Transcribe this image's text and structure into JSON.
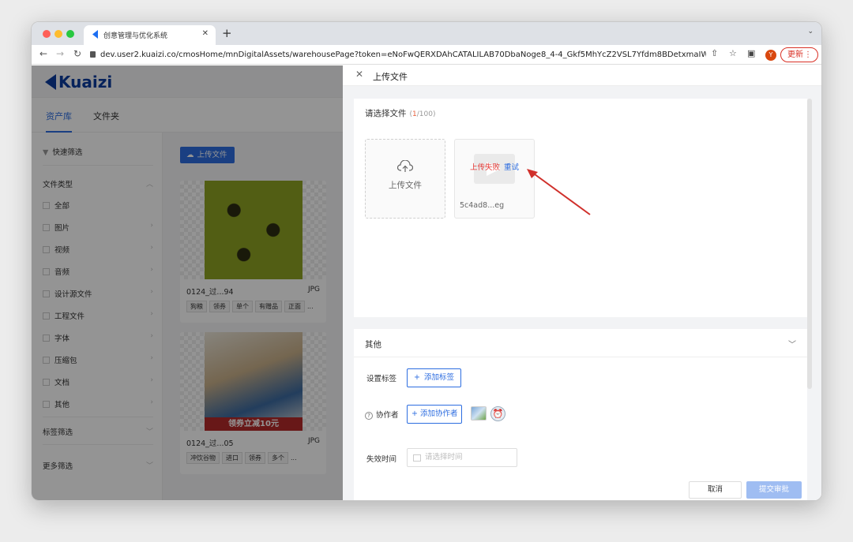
{
  "browser": {
    "tab_title": "创意管理与优化系统",
    "url": "dev.user2.kuaizi.co/cmosHome/mnDigitalAssets/warehousePage?token=eNoFwQERXDAhCATALILAB70DbaNoge8_4-4_Gkf5MhYcZ2VSL7Yfdm8BDetxmaIWJgoa...",
    "avatar_letter": "Y",
    "update_label": "更新"
  },
  "app": {
    "logo": "Kuaizi",
    "tabs": [
      "资产库",
      "文件夹"
    ],
    "upload_button": "上传文件"
  },
  "sidebar": {
    "quick_filter": "快速筛选",
    "file_type": "文件类型",
    "items": [
      "全部",
      "图片",
      "视频",
      "音频",
      "设计源文件",
      "工程文件",
      "字体",
      "压缩包",
      "文档",
      "其他"
    ],
    "tag_filter": "标签筛选",
    "more_filter": "更多筛选"
  },
  "cards": [
    {
      "name": "0124_过...94",
      "ext": "JPG",
      "tags": [
        "狗粮",
        "领券",
        "单个",
        "有赠品",
        "正面",
        "..."
      ]
    },
    {
      "name": "0124_过...05",
      "ext": "JPG",
      "tags": [
        "冲饮谷物",
        "进口",
        "领券",
        "多个",
        "..."
      ],
      "banner": "领券立减10元"
    }
  ],
  "drawer": {
    "title": "上传文件",
    "select_label": "请选择文件",
    "count_current": "1",
    "count_total": "/100",
    "upload_tile_label": "上传文件",
    "fail_text": "上传失败",
    "retry_text": "重试",
    "file_name": "5c4ad8...eg",
    "other_section": "其他",
    "tag_label": "设置标签",
    "add_tag": "添加标签",
    "collab_label": "协作者",
    "add_collab": "添加协作者",
    "expire_label": "失效时间",
    "date_placeholder": "请选择时间",
    "cancel": "取消",
    "submit": "提交审批"
  },
  "colors": {
    "primary": "#2d6de0",
    "error": "#e53935",
    "annotation_arrow": "#d0302b"
  }
}
